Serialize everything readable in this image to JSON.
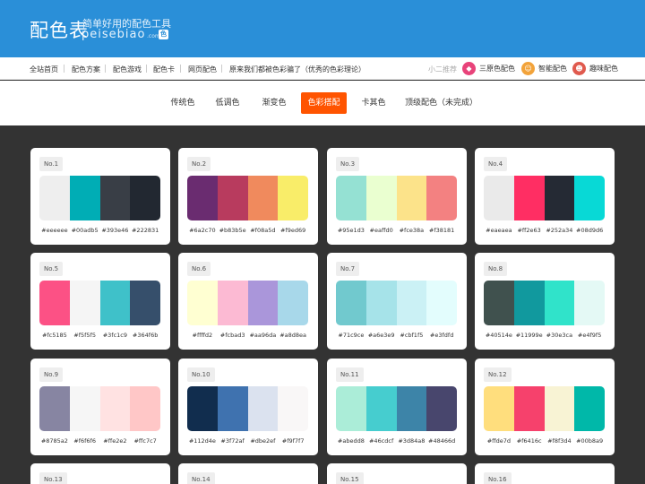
{
  "header": {
    "logo_cn": "配色表",
    "logo_sub": "简单好用的配色工具",
    "logo_en": "peisebiao",
    "logo_com": ".com",
    "logo_badge": "色",
    "bg_color": "#2a8fd8"
  },
  "topnav": {
    "items": [
      "全站首页",
      "配色方案",
      "配色游戏",
      "配色卡",
      "网页配色",
      "原来我们都被色彩骗了（优秀的色彩理论）"
    ],
    "rec_label": "小二推荐",
    "rec_items": [
      {
        "label": "三原色配色",
        "icon": "tri-color-icon",
        "color": "#e8437a"
      },
      {
        "label": "智能配色",
        "icon": "smart-face-icon",
        "color": "#f2a33a"
      },
      {
        "label": "趣味配色",
        "icon": "fun-face-icon",
        "color": "#e05a4e"
      }
    ]
  },
  "tabs": {
    "items": [
      "传统色",
      "低调色",
      "渐变色",
      "色彩搭配",
      "卡其色",
      "顶级配色（未完成）"
    ],
    "active_index": 3,
    "active_color": "#ff5400"
  },
  "palettes": [
    {
      "no": "No.1",
      "colors": [
        "#eeeeee",
        "#00adb5",
        "#393e46",
        "#222831"
      ]
    },
    {
      "no": "No.2",
      "colors": [
        "#6a2c70",
        "#b83b5e",
        "#f08a5d",
        "#f9ed69"
      ]
    },
    {
      "no": "No.3",
      "colors": [
        "#95e1d3",
        "#eaffd0",
        "#fce38a",
        "#f38181"
      ]
    },
    {
      "no": "No.4",
      "colors": [
        "#eaeaea",
        "#ff2e63",
        "#252a34",
        "#08d9d6"
      ]
    },
    {
      "no": "No.5",
      "colors": [
        "#fc5185",
        "#f5f5f5",
        "#3fc1c9",
        "#364f6b"
      ]
    },
    {
      "no": "No.6",
      "colors": [
        "#ffffd2",
        "#fcbad3",
        "#aa96da",
        "#a8d8ea"
      ]
    },
    {
      "no": "No.7",
      "colors": [
        "#71c9ce",
        "#a6e3e9",
        "#cbf1f5",
        "#e3fdfd"
      ]
    },
    {
      "no": "No.8",
      "colors": [
        "#40514e",
        "#11999e",
        "#30e3ca",
        "#e4f9f5"
      ]
    },
    {
      "no": "No.9",
      "colors": [
        "#8785a2",
        "#f6f6f6",
        "#ffe2e2",
        "#ffc7c7"
      ]
    },
    {
      "no": "No.10",
      "colors": [
        "#112d4e",
        "#3f72af",
        "#dbe2ef",
        "#f9f7f7"
      ]
    },
    {
      "no": "No.11",
      "colors": [
        "#abedd8",
        "#46cdcf",
        "#3d84a8",
        "#48466d"
      ]
    },
    {
      "no": "No.12",
      "colors": [
        "#ffde7d",
        "#f6416c",
        "#f8f3d4",
        "#00b8a9"
      ]
    },
    {
      "no": "No.13",
      "colors": []
    },
    {
      "no": "No.14",
      "colors": []
    },
    {
      "no": "No.15",
      "colors": []
    },
    {
      "no": "No.16",
      "colors": []
    }
  ]
}
